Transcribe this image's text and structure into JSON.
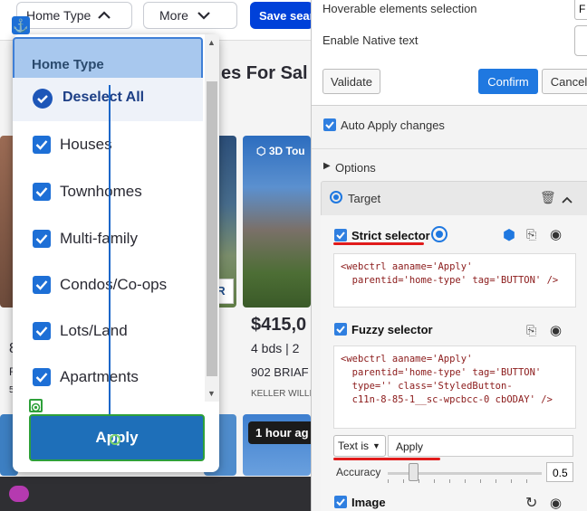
{
  "site": {
    "home_type_pill": "Home Type",
    "more_pill": "More",
    "save_search": "Save search",
    "heading": "es For Sal",
    "tour_badge": "3D Tou",
    "price": "$415,0",
    "beds": "4 bds | 2",
    "address": "902 BRIAF",
    "broker": "KELLER WILLI",
    "hour_tag": "1 hour ag",
    "left_edge_a": "8",
    "left_edge_b": "Rl",
    "left_edge_c": "5,",
    "sign_text": "R"
  },
  "dropdown": {
    "header": "Home Type",
    "deselect_all": "Deselect All",
    "options": [
      "Houses",
      "Townhomes",
      "Multi-family",
      "Condos/Co-ops",
      "Lots/Land",
      "Apartments"
    ],
    "apply": "Apply"
  },
  "inspector": {
    "hoverable_label": "Hoverable elements selection",
    "hoverable_value": "F",
    "native_text_label": "Enable Native text",
    "validate": "Validate",
    "confirm": "Confirm",
    "cancel": "Cancel",
    "auto_apply": "Auto Apply changes",
    "options": "Options",
    "target": "Target",
    "strict_selector": "Strict selector",
    "strict_code": "<webctrl aaname='Apply'\n  parentid='home-type' tag='BUTTON' />",
    "fuzzy_selector": "Fuzzy selector",
    "fuzzy_code": "<webctrl aaname='Apply'\n  parentid='home-type' tag='BUTTON'\n  type='' class='StyledButton-\n  c11n-8-85-1__sc-wpcbcc-0 cbODAY' />",
    "text_mode": "Text is",
    "text_value": "Apply",
    "accuracy_label": "Accuracy",
    "accuracy_value": "0.5",
    "image": "Image"
  },
  "colors": {
    "accent": "#1f78e0",
    "zillow_blue": "#0041d9",
    "apply_button": "#1e6fb9",
    "highlight_green": "#2ea03a",
    "underline_red": "#e01b1b"
  }
}
